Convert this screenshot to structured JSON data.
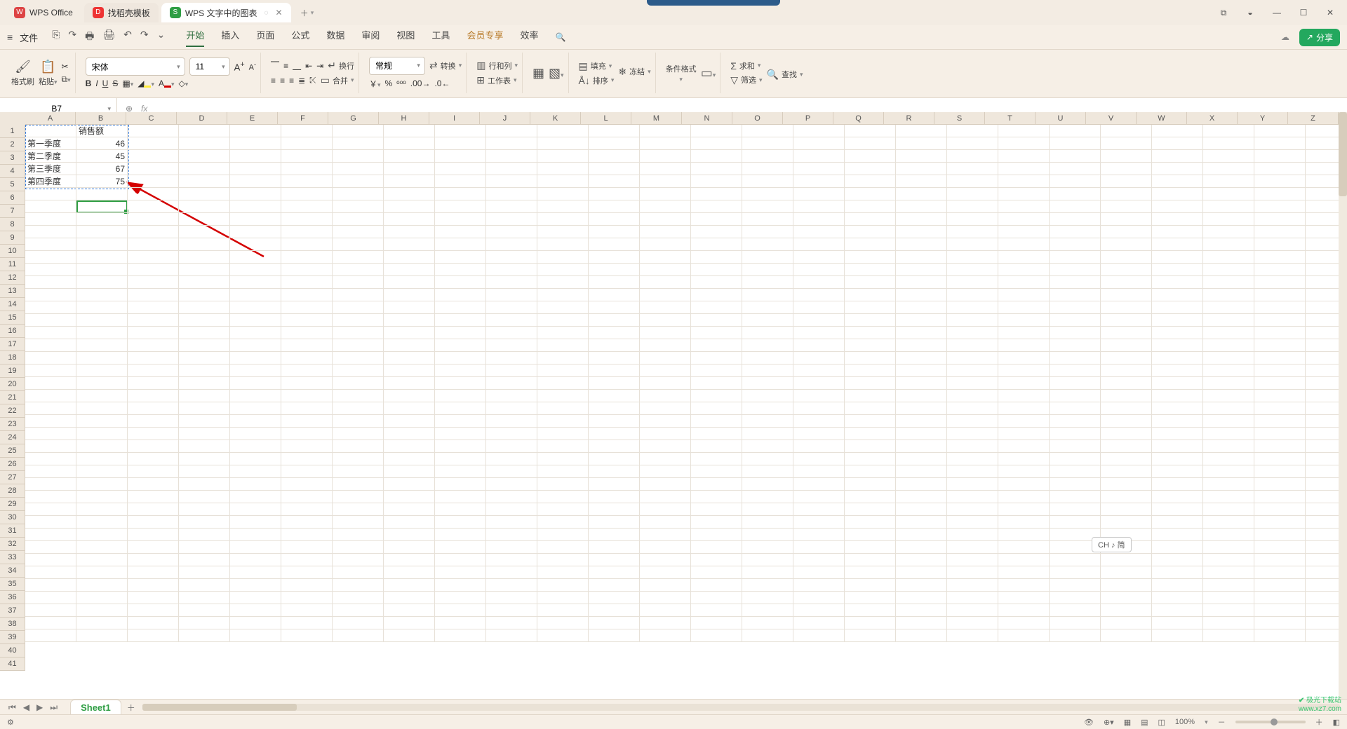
{
  "tabs": {
    "home": "WPS Office",
    "template": "找稻壳模板",
    "doc": "WPS 文字中的图表"
  },
  "window": {
    "cube": "⧉",
    "user": "◒",
    "min": "—",
    "max": "☐",
    "close": "✕"
  },
  "menubar": {
    "file": "文件",
    "qa": [
      "⎘",
      "↷",
      "🖶",
      "🖨",
      "↶",
      "↷",
      "⌄"
    ],
    "tabs": [
      "开始",
      "插入",
      "页面",
      "公式",
      "数据",
      "审阅",
      "视图",
      "工具",
      "会员专享",
      "效率"
    ],
    "active_index": 0,
    "member_index": 8,
    "share": "分享"
  },
  "ribbon": {
    "clipboard": {
      "format_painter": "格式刷",
      "paste": "粘贴",
      "cut": "✂"
    },
    "font": {
      "name": "宋体",
      "size": "11",
      "incA": "A",
      "decA": "A",
      "bold": "B",
      "italic": "I",
      "underline": "U",
      "strike": "S"
    },
    "align": {
      "wrap": "换行",
      "merge": "合并"
    },
    "number": {
      "format": "常规",
      "convert": "转换"
    },
    "cells": {
      "rowcol": "行和列",
      "worksheet": "工作表"
    },
    "style": {
      "cond": "条件格式"
    },
    "editing": {
      "sum": "求和",
      "fill": "填充",
      "sort": "排序",
      "freeze": "冻结",
      "filter": "筛选",
      "find": "查找"
    }
  },
  "fx": {
    "namebox": "B7",
    "formula": ""
  },
  "columns": [
    "A",
    "B",
    "C",
    "D",
    "E",
    "F",
    "G",
    "H",
    "I",
    "J",
    "K",
    "L",
    "M",
    "N",
    "O",
    "P",
    "Q",
    "R",
    "S",
    "T",
    "U",
    "V",
    "W",
    "X",
    "Y",
    "Z"
  ],
  "row_count": 41,
  "chart_data": {
    "type": "table",
    "title": "销售额",
    "categories": [
      "第一季度",
      "第二季度",
      "第三季度",
      "第四季度"
    ],
    "values": [
      46,
      45,
      67,
      75
    ]
  },
  "cells": {
    "B1": "销售额",
    "A2": "第一季度",
    "B2": "46",
    "A3": "第二季度",
    "B3": "45",
    "A4": "第三季度",
    "B4": "67",
    "A5": "第四季度",
    "B5": "75"
  },
  "selection": {
    "copy_range": "A1:B5",
    "active": "B7"
  },
  "sheet": {
    "name": "Sheet1"
  },
  "status": {
    "zoom": "100%",
    "ime": "CH ♪ 简"
  },
  "watermark": {
    "l1": "极光下载站",
    "l2": "www.xz7.com"
  }
}
